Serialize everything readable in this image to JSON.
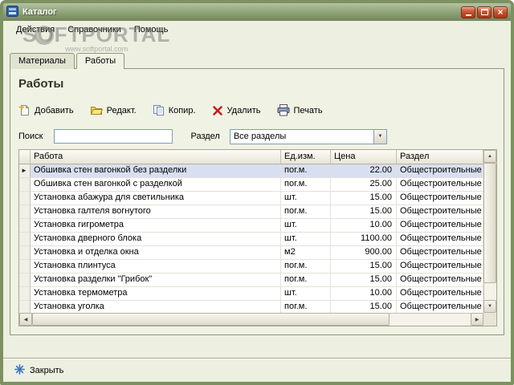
{
  "window": {
    "title": "Каталог"
  },
  "menu": {
    "items": [
      {
        "label": "Действия"
      },
      {
        "label": "Справочники"
      },
      {
        "label": "Помощь"
      }
    ]
  },
  "watermark": {
    "line1": "SOFTPORTAL",
    "line2": "www.softportal.com"
  },
  "tabs": [
    {
      "label": "Материалы",
      "active": false
    },
    {
      "label": "Работы",
      "active": true
    }
  ],
  "page": {
    "title": "Работы"
  },
  "toolbar": {
    "buttons": [
      {
        "label": "Добавить",
        "icon": "new-document-icon"
      },
      {
        "label": "Редакт.",
        "icon": "open-folder-icon"
      },
      {
        "label": "Копир.",
        "icon": "copy-icon"
      },
      {
        "label": "Удалить",
        "icon": "red-cross-icon"
      },
      {
        "label": "Печать",
        "icon": "printer-icon"
      }
    ]
  },
  "filters": {
    "search_label": "Поиск",
    "search_value": "",
    "section_label": "Раздел",
    "section_value": "Все разделы"
  },
  "table": {
    "columns": [
      "Работа",
      "Ед.изм.",
      "Цена",
      "Раздел"
    ],
    "rows": [
      {
        "work": "Обшивка стен вагонкой без разделки",
        "unit": "пог.м.",
        "price": "22.00",
        "section": "Общестроительные ра",
        "selected": true
      },
      {
        "work": "Обшивка стен вагонкой с разделкой",
        "unit": "пог.м.",
        "price": "25.00",
        "section": "Общестроительные ра",
        "selected": false
      },
      {
        "work": "Установка абажура для светильника",
        "unit": "шт.",
        "price": "15.00",
        "section": "Общестроительные ра",
        "selected": false
      },
      {
        "work": "Установка галтеля вогнутого",
        "unit": "пог.м.",
        "price": "15.00",
        "section": "Общестроительные ра",
        "selected": false
      },
      {
        "work": "Установка гигрометра",
        "unit": "шт.",
        "price": "10.00",
        "section": "Общестроительные ра",
        "selected": false
      },
      {
        "work": "Установка дверного блока",
        "unit": "шт.",
        "price": "1100.00",
        "section": "Общестроительные ра",
        "selected": false
      },
      {
        "work": "Установка и отделка окна",
        "unit": "м2",
        "price": "900.00",
        "section": "Общестроительные ра",
        "selected": false
      },
      {
        "work": "Установка плинтуса",
        "unit": "пог.м.",
        "price": "15.00",
        "section": "Общестроительные ра",
        "selected": false
      },
      {
        "work": "Установка разделки \"Грибок\"",
        "unit": "пог.м.",
        "price": "15.00",
        "section": "Общестроительные ра",
        "selected": false
      },
      {
        "work": "Установка термометра",
        "unit": "шт.",
        "price": "10.00",
        "section": "Общестроительные ра",
        "selected": false
      },
      {
        "work": "Установка уголка",
        "unit": "пог.м.",
        "price": "15.00",
        "section": "Общестроительные ра",
        "selected": false
      }
    ]
  },
  "footer": {
    "close_label": "Закрыть"
  },
  "theme": {
    "titlebar_green": "#8CA174",
    "window_border": "#7C9160",
    "selection_blue": "#D8DFF0",
    "close_button_red": "#C84E2C",
    "footer_icon_blue": "#3D74C6"
  }
}
